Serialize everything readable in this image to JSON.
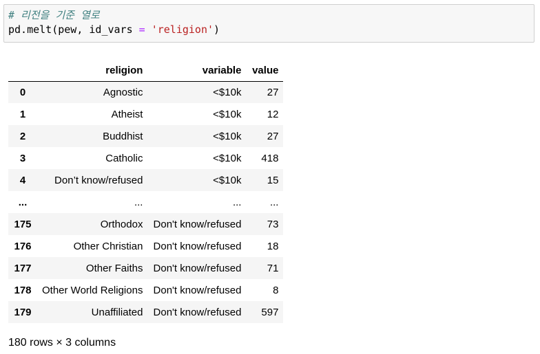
{
  "code": {
    "comment": "# 리전을 기준 열로",
    "fn": "pd.melt(pew, id_vars ",
    "op": "=",
    "space": " ",
    "str": "'religion'",
    "close": ")"
  },
  "table": {
    "columns": [
      "",
      "religion",
      "variable",
      "value"
    ],
    "rows": [
      {
        "idx": "0",
        "religion": "Agnostic",
        "variable": "<$10k",
        "value": "27"
      },
      {
        "idx": "1",
        "religion": "Atheist",
        "variable": "<$10k",
        "value": "12"
      },
      {
        "idx": "2",
        "religion": "Buddhist",
        "variable": "<$10k",
        "value": "27"
      },
      {
        "idx": "3",
        "religion": "Catholic",
        "variable": "<$10k",
        "value": "418"
      },
      {
        "idx": "4",
        "religion": "Don’t know/refused",
        "variable": "<$10k",
        "value": "15"
      },
      {
        "idx": "...",
        "religion": "...",
        "variable": "...",
        "value": "..."
      },
      {
        "idx": "175",
        "religion": "Orthodox",
        "variable": "Don't know/refused",
        "value": "73"
      },
      {
        "idx": "176",
        "religion": "Other Christian",
        "variable": "Don't know/refused",
        "value": "18"
      },
      {
        "idx": "177",
        "religion": "Other Faiths",
        "variable": "Don't know/refused",
        "value": "71"
      },
      {
        "idx": "178",
        "religion": "Other World Religions",
        "variable": "Don't know/refused",
        "value": "8"
      },
      {
        "idx": "179",
        "religion": "Unaffiliated",
        "variable": "Don't know/refused",
        "value": "597"
      }
    ]
  },
  "shape_text": "180 rows × 3 columns"
}
